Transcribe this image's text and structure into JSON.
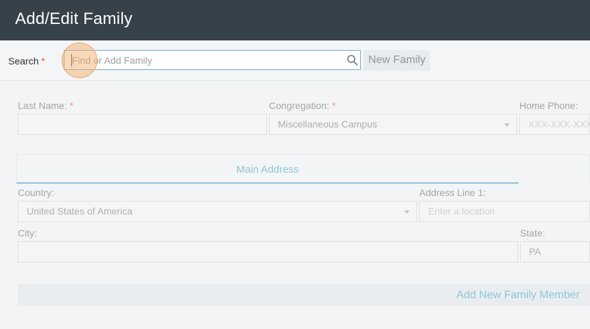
{
  "header": {
    "title": "Add/Edit Family"
  },
  "search": {
    "label": "Search",
    "required_mark": "*",
    "placeholder": "Find or Add Family",
    "value": "",
    "icon": "search-icon",
    "new_family_label": "New Family"
  },
  "family": {
    "last_name_label": "Last Name:",
    "last_name_required": "*",
    "last_name_value": "",
    "congregation_label": "Congregation:",
    "congregation_required": "*",
    "congregation_value": "Miscellaneous Campus",
    "home_phone_label": "Home Phone:",
    "home_phone_placeholder": "XXX-XXX-XXXX"
  },
  "address": {
    "tab_label": "Main Address",
    "country_label": "Country:",
    "country_value": "United States of America",
    "address_line1_label": "Address Line 1:",
    "address_line1_placeholder": "Enter a location",
    "city_label": "City:",
    "city_value": "",
    "state_label": "State:",
    "state_value": "PA"
  },
  "members": {
    "add_label": "Add New Family Member"
  },
  "colors": {
    "accent": "#3aa0bf",
    "header_bg": "#37414a",
    "required": "#d9534f",
    "focus_highlight": "#f5aa64"
  }
}
